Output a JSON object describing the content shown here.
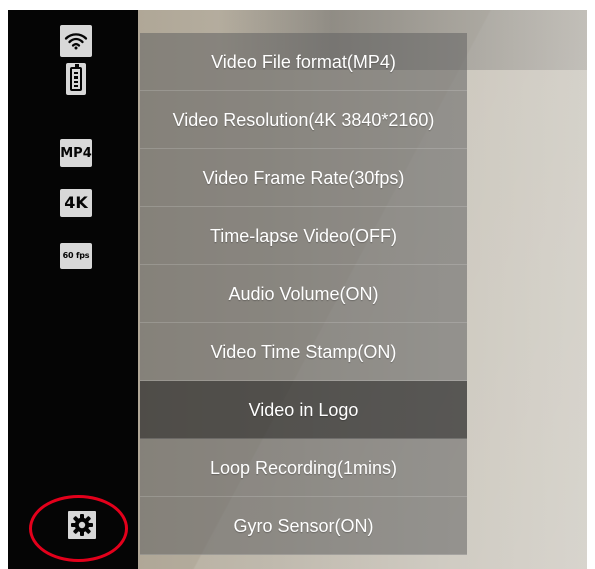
{
  "sidebar": {
    "status_icons": [
      {
        "name": "wifi-icon",
        "type": "icon"
      },
      {
        "name": "battery-icon",
        "type": "icon",
        "level": 0.8
      },
      {
        "name": "mp4-badge",
        "type": "badge",
        "text": "MP4"
      },
      {
        "name": "4k-badge",
        "type": "badge",
        "text": "4K"
      },
      {
        "name": "60fps-badge",
        "type": "badge",
        "text": "60 fps"
      }
    ],
    "settings_icon": "gear-icon"
  },
  "menu": {
    "items": [
      {
        "label": "Video File format(MP4)"
      },
      {
        "label": "Video Resolution(4K 3840*2160)"
      },
      {
        "label": "Video Frame Rate(30fps)"
      },
      {
        "label": "Time-lapse Video(OFF)"
      },
      {
        "label": "Audio Volume(ON)"
      },
      {
        "label": "Video Time Stamp(ON)"
      },
      {
        "label": "Video in Logo",
        "selected": true
      },
      {
        "label": "Loop Recording(1mins)"
      },
      {
        "label": "Gyro Sensor(ON)"
      }
    ]
  },
  "colors": {
    "sidebar_background": "#050505",
    "badge_background": "#d8d8d8",
    "menu_item_background": "#626262",
    "selected_menu_item_background": "#2a2a2a",
    "highlight_circle": "#e3001b",
    "menu_text": "#ffffff"
  }
}
